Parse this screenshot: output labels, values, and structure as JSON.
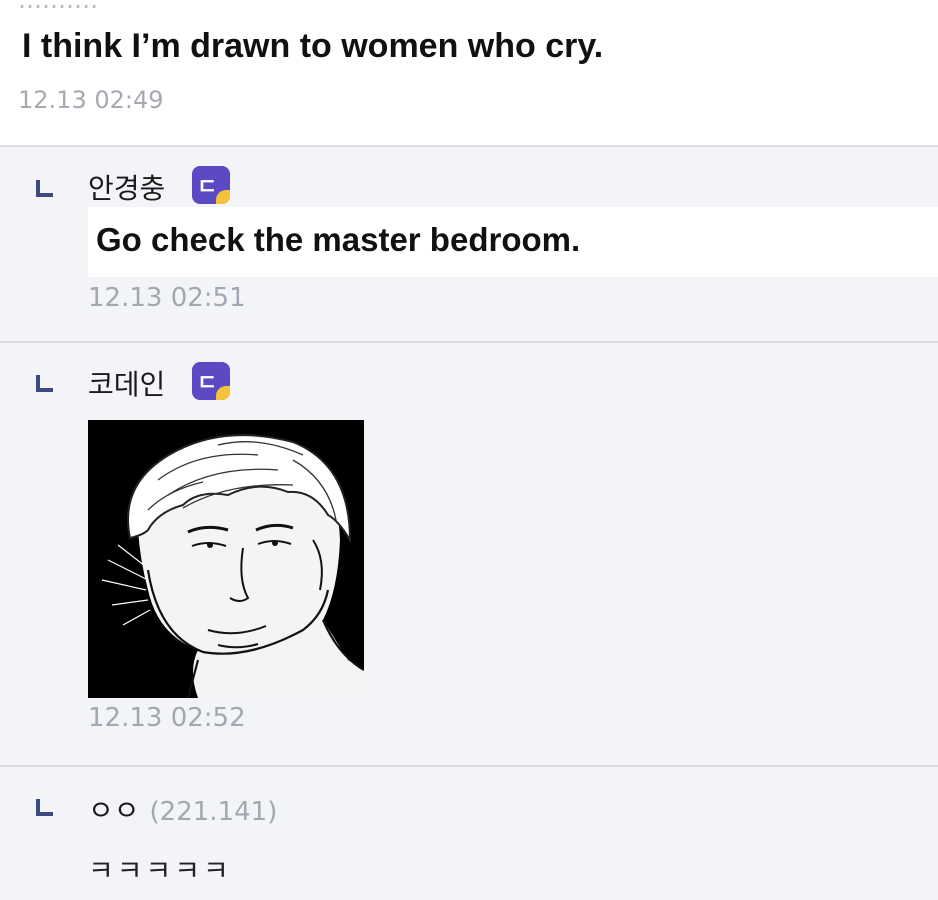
{
  "post": {
    "text": "I think I’m drawn to women who cry.",
    "timestamp": "12.13 02:49"
  },
  "replies": [
    {
      "author": "안경충",
      "badge_icon": "gallery-member-icon",
      "text": "Go check the master bedroom.",
      "timestamp": "12.13 02:51"
    },
    {
      "author": "코데인",
      "badge_icon": "gallery-member-icon",
      "image": "manga-face-reaction-image",
      "timestamp": "12.13 02:52"
    },
    {
      "author": "ㅇㅇ",
      "ip": "(221.141)",
      "text": "ㅋㅋㅋㅋㅋ"
    }
  ],
  "colors": {
    "reply_background": "#f3f4f7",
    "divider": "#dcdde3",
    "reply_mark": "#3c4a7e",
    "badge": "#5b4ac4",
    "badge_accent": "#f5c33b",
    "timestamp": "#a4a6b2"
  }
}
